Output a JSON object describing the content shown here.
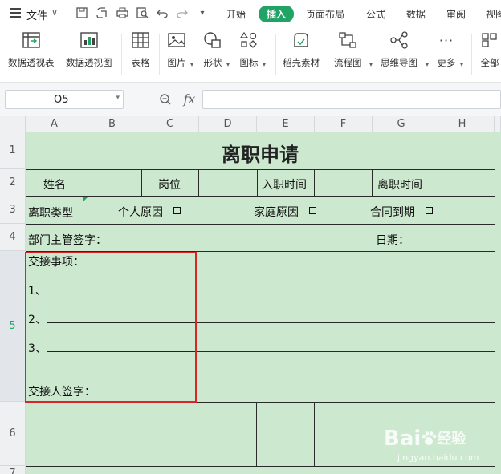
{
  "menubar": {
    "file_label": "文件",
    "tabs": [
      "开始",
      "插入",
      "页面布局",
      "公式",
      "数据",
      "审阅",
      "视图"
    ],
    "active_tab": "插入"
  },
  "ribbon": {
    "items": [
      {
        "label": "数据透视表",
        "icon": "pivot-table-icon"
      },
      {
        "label": "数据透视图",
        "icon": "pivot-chart-icon"
      },
      {
        "label": "表格",
        "icon": "table-icon"
      },
      {
        "label": "图片",
        "icon": "picture-icon"
      },
      {
        "label": "形状",
        "icon": "shape-icon"
      },
      {
        "label": "图标",
        "icon": "icons-icon"
      },
      {
        "label": "稻壳素材",
        "icon": "docer-material-icon"
      },
      {
        "label": "流程图",
        "icon": "flowchart-icon"
      },
      {
        "label": "思维导图",
        "icon": "mindmap-icon"
      },
      {
        "label": "更多",
        "icon": "more-icon"
      },
      {
        "label": "全部",
        "icon": "all-icon"
      }
    ]
  },
  "formula_bar": {
    "name_box": "O5",
    "fx": "fx",
    "formula": ""
  },
  "sheet": {
    "columns": [
      "A",
      "B",
      "C",
      "D",
      "E",
      "F",
      "G",
      "H"
    ],
    "rows": [
      "1",
      "2",
      "3",
      "4",
      "5",
      "6",
      "7"
    ],
    "selected_row": "5",
    "title": "离职申请",
    "row2": {
      "name": "姓名",
      "position": "岗位",
      "hire_date": "入职时间",
      "leave_date": "离职时间"
    },
    "row3": {
      "type_label": "离职类型",
      "opt1": "个人原因",
      "opt2": "家庭原因",
      "opt3": "合同到期"
    },
    "row4": {
      "supervisor": "部门主管签字：",
      "date": "日期："
    },
    "row5": {
      "handover": "交接事项：",
      "item1": "1、",
      "item2": "2、",
      "item3": "3、",
      "signer": "交接人签字："
    }
  },
  "watermark": {
    "brand": "Bai",
    "brand2": "经验",
    "url": "jingyan.baidu.com"
  },
  "colors": {
    "accent": "#21a366",
    "cell_bg": "#cce8cf",
    "selection": "#d9242a"
  }
}
